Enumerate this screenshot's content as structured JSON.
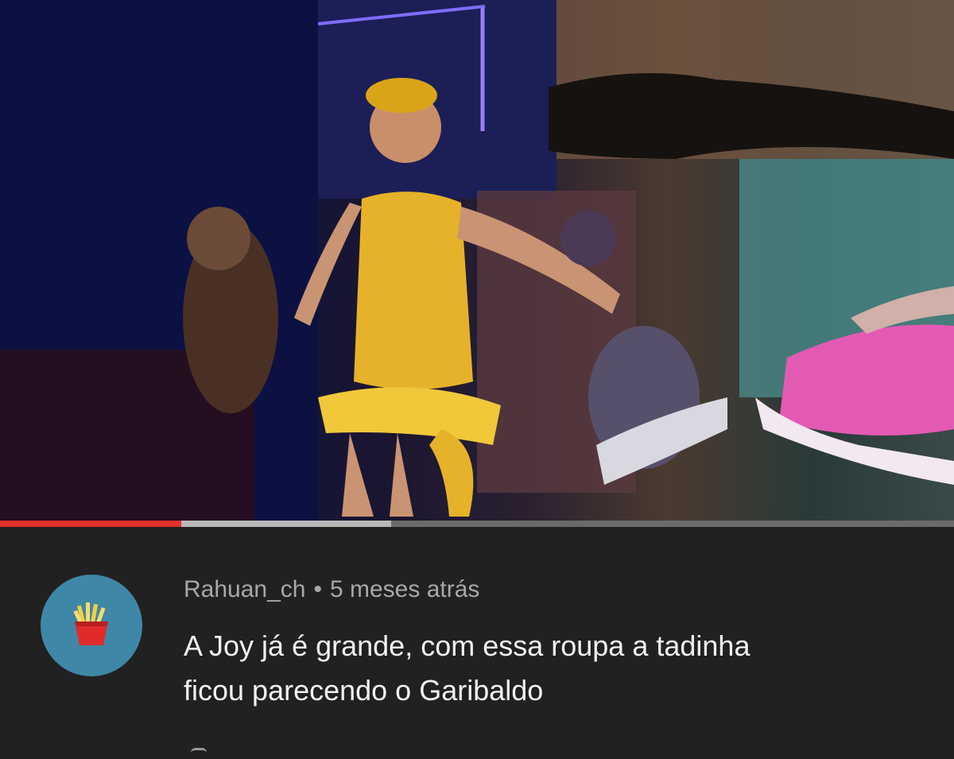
{
  "video": {
    "scene": "concert-stage-performance",
    "progress_played_fraction": 0.19,
    "progress_buffered_fraction": 0.41
  },
  "comment": {
    "author": "Rahuan_ch",
    "separator": "•",
    "time": "5 meses atrás",
    "text_line1": "A Joy já é grande, com essa roupa a tadinha",
    "text_line2": "ficou parecendo o Garibaldo",
    "avatar_icon": "french-fries-icon"
  },
  "colors": {
    "background": "#212121",
    "progress_played": "#e3302c",
    "progress_buffered": "#b8b8b8",
    "avatar_bg": "#3f87a6",
    "meta_text": "#a8a8a8",
    "comment_text": "#f2f2f2"
  }
}
